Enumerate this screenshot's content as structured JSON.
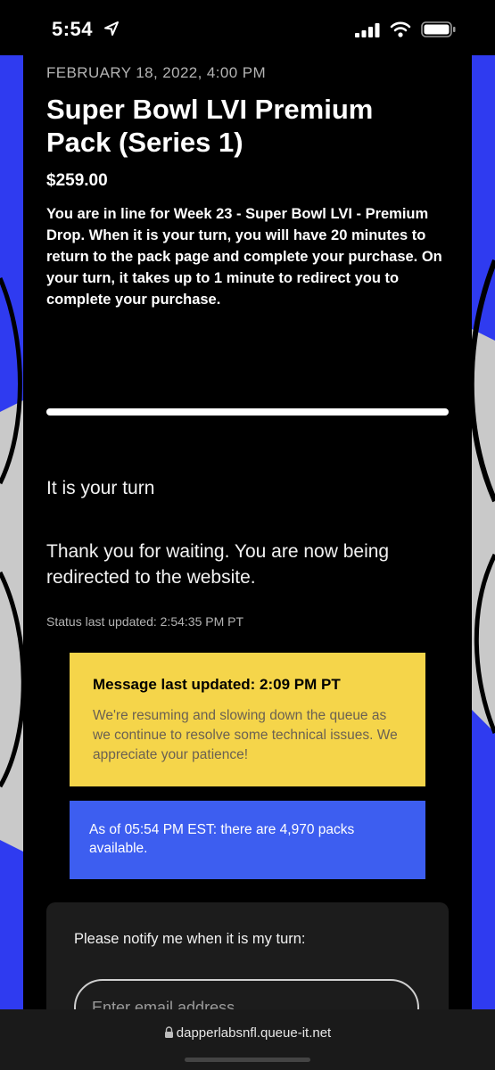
{
  "status_bar": {
    "time": "5:54",
    "icons": [
      "location-arrow-icon",
      "cellular-signal-icon",
      "wifi-icon",
      "battery-icon"
    ]
  },
  "colors": {
    "side_art_blue": "#2f3bf0",
    "message_box": "#f5d54a",
    "availability_box": "#3d5ef0",
    "progress_fill": "#ffffff"
  },
  "drop": {
    "date": "FEBRUARY 18, 2022, 4:00 PM",
    "title": "Super Bowl LVI Premium Pack (Series 1)",
    "price": "$259.00",
    "queue_text": "You are in line for Week 23 - Super Bowl LVI - Premium Drop. When it is your turn, you will have 20 minutes to return to the pack page and complete your purchase. On your turn, it takes up to 1 minute to redirect you to complete your purchase."
  },
  "queue": {
    "progress_fraction": 1.0,
    "turn_text": "It is your turn",
    "redirect_text": "Thank you for waiting. You are now being redirected to the website.",
    "status_updated": "Status last updated: 2:54:35 PM PT"
  },
  "message": {
    "heading": "Message last updated: 2:09 PM PT",
    "body": "We're resuming and slowing down the queue as we continue to resolve some technical issues. We appreciate your patience!"
  },
  "availability": {
    "text": "As of 05:54 PM EST: there are 4,970 packs available."
  },
  "notify": {
    "label": "Please notify me when it is my turn:",
    "email_placeholder": "Enter email address",
    "email_value": ""
  },
  "browser": {
    "url": "dapperlabsnfl.queue-it.net"
  }
}
